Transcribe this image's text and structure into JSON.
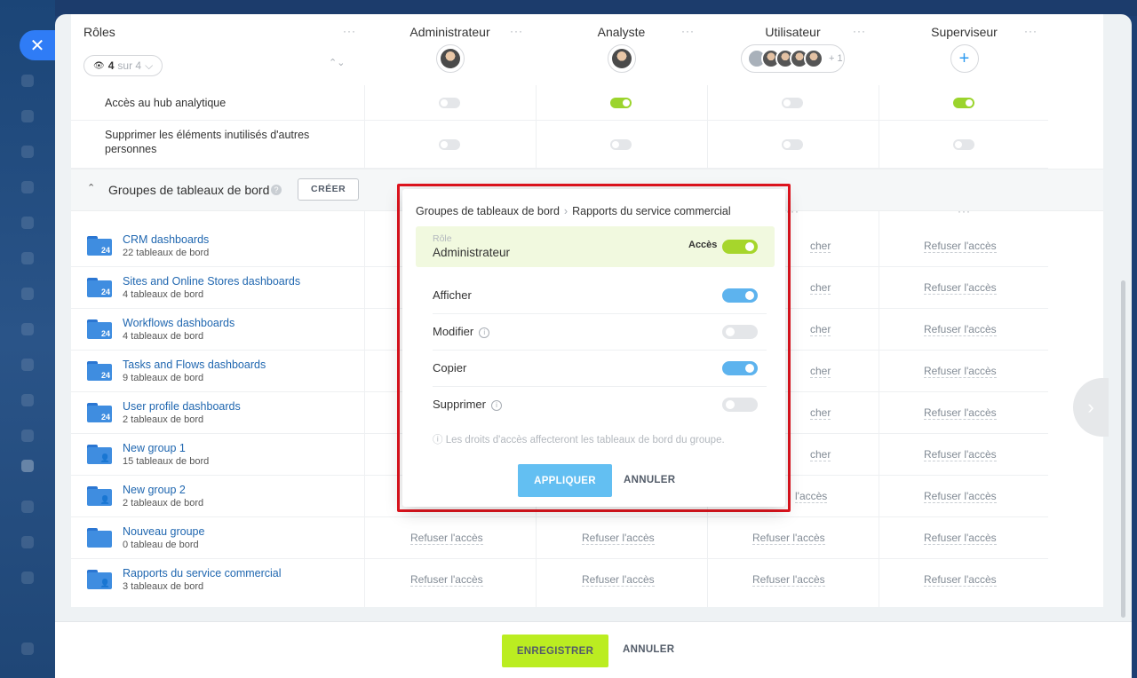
{
  "close_icon": "✕",
  "header": {
    "roles_label": "Rôles",
    "more_dots": "···",
    "counter": {
      "eye_icon": "👁",
      "count": "4",
      "suffix": "sur 4",
      "chevron": "⌵"
    },
    "expand_icon": "⌃⌄",
    "columns": [
      {
        "name": "Administrateur",
        "avatar": "single"
      },
      {
        "name": "Analyste",
        "avatar": "single"
      },
      {
        "name": "Utilisateur",
        "avatar": "group",
        "more": "+ 1"
      },
      {
        "name": "Superviseur",
        "avatar": "plus",
        "plus_icon": "+"
      }
    ]
  },
  "permissions": [
    {
      "label": "Accès au hub analytique",
      "values": [
        false,
        true,
        false,
        true
      ]
    },
    {
      "label": "Supprimer les éléments inutilisés d'autres personnes",
      "values": [
        false,
        false,
        false,
        false
      ]
    }
  ],
  "section": {
    "chevron_icon": "⌃",
    "title": "Groupes de tableaux de bord",
    "help_icon": "?",
    "create_label": "CRÉER"
  },
  "deny_label": "Refuser l'accès",
  "partial_deny_label_1": "cher",
  "partial_deny_label_2": "l'accès",
  "groups": [
    {
      "name": "CRM dashboards",
      "sub": "22 tableaux de bord",
      "mark": "24"
    },
    {
      "name": "Sites and Online Stores dashboards",
      "sub": "4 tableaux de bord",
      "mark": "24"
    },
    {
      "name": "Workflows dashboards",
      "sub": "4 tableaux de bord",
      "mark": "24"
    },
    {
      "name": "Tasks and Flows dashboards",
      "sub": "9 tableaux de bord",
      "mark": "24"
    },
    {
      "name": "User profile dashboards",
      "sub": "2 tableaux de bord",
      "mark": "24"
    },
    {
      "name": "New group 1",
      "sub": "15 tableaux de bord",
      "mark": "👤"
    },
    {
      "name": "New group 2",
      "sub": "2 tableaux de bord",
      "mark": "👤"
    },
    {
      "name": "Nouveau groupe",
      "sub": "0 tableau de bord",
      "mark": ""
    },
    {
      "name": "Rapports du service commercial",
      "sub": "3 tableaux de bord",
      "mark": "👤"
    }
  ],
  "popup": {
    "crumb_root": "Groupes de tableaux de bord",
    "crumb_sep": "›",
    "crumb_leaf": "Rapports du service commercial",
    "role_label": "Rôle",
    "role_value": "Administrateur",
    "access_label": "Accès",
    "options": [
      {
        "label": "Afficher",
        "info": false,
        "on": true
      },
      {
        "label": "Modifier",
        "info": true,
        "on": false
      },
      {
        "label": "Copier",
        "info": false,
        "on": true
      },
      {
        "label": "Supprimer",
        "info": true,
        "on": false
      }
    ],
    "info_icon": "i",
    "note": "ⓘ Les droits d'accès affecteront les tableaux de bord du groupe.",
    "apply_label": "APPLIQUER",
    "cancel_label": "ANNULER"
  },
  "footer": {
    "save_label": "ENREGISTRER",
    "cancel_label": "ANNULER"
  },
  "next_icon": "›"
}
